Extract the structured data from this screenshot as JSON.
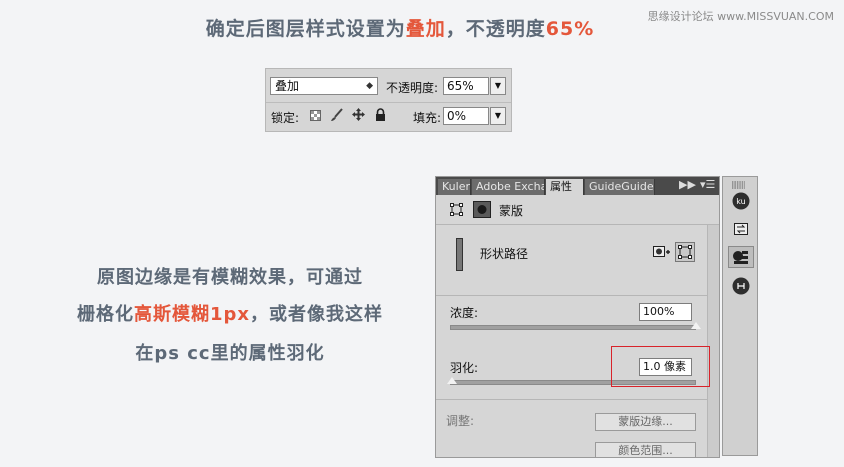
{
  "watermark": "思缘设计论坛 www.MISSVUAN.COM",
  "title": {
    "prefix": "确定后图层样式设置为",
    "highlight": "叠加",
    "middle": "，不透明度",
    "value": "65%"
  },
  "layers": {
    "blend_mode": "叠加",
    "opacity_label": "不透明度:",
    "opacity_value": "65%",
    "lock_label": "锁定:",
    "fill_label": "填充:",
    "fill_value": "0%",
    "dropdown_icon": "chevron-down-icon",
    "lock_icons": [
      "lock-transparent-icon",
      "lock-brush-icon",
      "lock-move-icon",
      "lock-all-icon"
    ]
  },
  "note": {
    "line1": "原图边缘是有模糊效果，可通过",
    "line2_prefix": "栅格化",
    "line2_highlight": "高斯模糊1px",
    "line2_suffix": "，或者像我这样",
    "line3": "在ps cc里的属性羽化"
  },
  "properties": {
    "tabs": [
      "Kuler",
      "Adobe Exchar",
      "属性",
      "GuideGuide"
    ],
    "active_tab": "属性",
    "header_label": "蒙版",
    "path_label": "形状路径",
    "density_label": "浓度:",
    "density_value": "100%",
    "density_level": 1.0,
    "feather_label": "羽化:",
    "feather_value": "1.0 像素",
    "feather_level": 0.01,
    "adjust_label": "调整:",
    "mask_edge_button": "蒙版边缘...",
    "color_range_button": "颜色范围..."
  },
  "dock": {
    "icons": [
      "kuler-icon",
      "exchange-icon",
      "properties-icon",
      "guideguide-icon"
    ],
    "kuler_text": "ku"
  },
  "colors": {
    "accent": "#e4573b",
    "text": "#5d6977",
    "panel": "#d6d6d6",
    "highlight_box": "#d8232a"
  }
}
